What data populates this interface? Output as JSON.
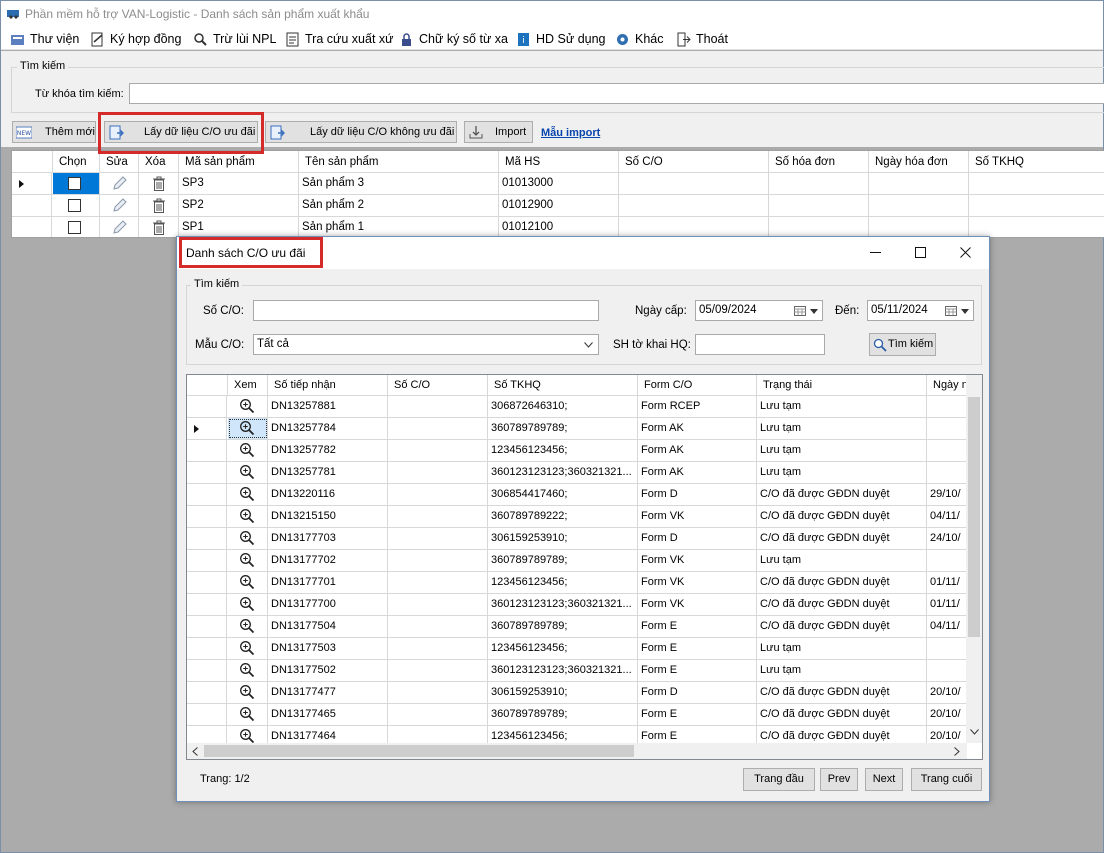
{
  "window": {
    "title": "Phần mềm hỗ trợ VAN-Logistic - Danh sách sản phẩm xuất khẩu"
  },
  "menu": [
    {
      "label": "Thư viện",
      "icon": "library-icon"
    },
    {
      "label": "Ký hợp đồng",
      "icon": "sign-contract-icon"
    },
    {
      "label": "Trừ lùi NPL",
      "icon": "search-deduct-icon"
    },
    {
      "label": "Tra cứu xuất xứ",
      "icon": "lookup-origin-icon"
    },
    {
      "label": "Chữ ký số từ xa",
      "icon": "remote-signature-icon"
    },
    {
      "label": "HD Sử dụng",
      "icon": "help-icon"
    },
    {
      "label": "Khác",
      "icon": "gear-icon"
    },
    {
      "label": "Thoát",
      "icon": "exit-icon"
    }
  ],
  "search": {
    "group_label": "Tìm kiếm",
    "keyword_label": "Từ khóa tìm kiếm:",
    "keyword_value": ""
  },
  "toolbar": {
    "add_new": "Thêm mới",
    "get_preferential": "Lấy dữ liệu C/O ưu đãi",
    "get_non_preferential": "Lấy dữ liệu C/O không ưu đãi",
    "import": "Import",
    "import_template": "Mẫu import"
  },
  "product_grid": {
    "columns": [
      "Chọn",
      "Sửa",
      "Xóa",
      "Mã sản phẩm",
      "Tên sản phẩm",
      "Mã HS",
      "Số C/O",
      "Số hóa đơn",
      "Ngày hóa đơn",
      "Số TKHQ"
    ],
    "rows": [
      {
        "code": "SP3",
        "name": "Sản phẩm 3",
        "hs": "01013000",
        "co": "",
        "invoice": "",
        "invoice_date": "",
        "tkhq": ""
      },
      {
        "code": "SP2",
        "name": "Sản phẩm 2",
        "hs": "01012900",
        "co": "",
        "invoice": "",
        "invoice_date": "",
        "tkhq": ""
      },
      {
        "code": "SP1",
        "name": "Sản phẩm 1",
        "hs": "01012100",
        "co": "",
        "invoice": "",
        "invoice_date": "",
        "tkhq": ""
      }
    ]
  },
  "dialog": {
    "title": "Danh sách C/O ưu đãi",
    "search_group": "Tìm kiếm",
    "co_number_label": "Số C/O:",
    "co_number_value": "",
    "issue_date_label": "Ngày cấp:",
    "date_from": "05/09/2024",
    "to_label": "Đến:",
    "date_to": "05/11/2024",
    "form_label": "Mẫu C/O:",
    "form_value": "Tất cả",
    "declaration_label": "SH tờ khai HQ:",
    "declaration_value": "",
    "search_button": "Tìm kiếm",
    "grid": {
      "columns": [
        "Xem",
        "Số tiếp nhận",
        "Số C/O",
        "Số TKHQ",
        "Form C/O",
        "Trạng thái",
        "Ngày n"
      ],
      "rows": [
        {
          "receipt": "DN13257881",
          "co": "",
          "tkhq": "306872646310;",
          "form": "Form RCEP",
          "status": "Lưu tạm",
          "date": ""
        },
        {
          "receipt": "DN13257784",
          "co": "",
          "tkhq": "360789789789;",
          "form": "Form AK",
          "status": "Lưu tạm",
          "date": ""
        },
        {
          "receipt": "DN13257782",
          "co": "",
          "tkhq": "123456123456;",
          "form": "Form AK",
          "status": "Lưu tạm",
          "date": ""
        },
        {
          "receipt": "DN13257781",
          "co": "",
          "tkhq": "360123123123;360321321...",
          "form": "Form AK",
          "status": "Lưu tạm",
          "date": ""
        },
        {
          "receipt": "DN13220116",
          "co": "",
          "tkhq": "306854417460;",
          "form": "Form D",
          "status": "C/O đã được GĐDN duyệt",
          "date": "29/10/"
        },
        {
          "receipt": "DN13215150",
          "co": "",
          "tkhq": "360789789222;",
          "form": "Form VK",
          "status": "C/O đã được GĐDN duyệt",
          "date": "04/11/"
        },
        {
          "receipt": "DN13177703",
          "co": "",
          "tkhq": "306159253910;",
          "form": "Form D",
          "status": "C/O đã được GĐDN duyệt",
          "date": "24/10/"
        },
        {
          "receipt": "DN13177702",
          "co": "",
          "tkhq": "360789789789;",
          "form": "Form VK",
          "status": "Lưu tạm",
          "date": ""
        },
        {
          "receipt": "DN13177701",
          "co": "",
          "tkhq": "123456123456;",
          "form": "Form VK",
          "status": "C/O đã được GĐDN duyệt",
          "date": "01/11/"
        },
        {
          "receipt": "DN13177700",
          "co": "",
          "tkhq": "360123123123;360321321...",
          "form": "Form VK",
          "status": "C/O đã được GĐDN duyệt",
          "date": "01/11/"
        },
        {
          "receipt": "DN13177504",
          "co": "",
          "tkhq": "360789789789;",
          "form": "Form E",
          "status": "C/O đã được GĐDN duyệt",
          "date": "04/11/"
        },
        {
          "receipt": "DN13177503",
          "co": "",
          "tkhq": "123456123456;",
          "form": "Form E",
          "status": "Lưu tạm",
          "date": ""
        },
        {
          "receipt": "DN13177502",
          "co": "",
          "tkhq": "360123123123;360321321...",
          "form": "Form E",
          "status": "Lưu tạm",
          "date": ""
        },
        {
          "receipt": "DN13177477",
          "co": "",
          "tkhq": "306159253910;",
          "form": "Form D",
          "status": "C/O đã được GĐDN duyệt",
          "date": "20/10/"
        },
        {
          "receipt": "DN13177465",
          "co": "",
          "tkhq": "360789789789;",
          "form": "Form E",
          "status": "C/O đã được GĐDN duyệt",
          "date": "20/10/"
        },
        {
          "receipt": "DN13177464",
          "co": "",
          "tkhq": "123456123456;",
          "form": "Form E",
          "status": "C/O đã được GĐDN duyệt",
          "date": "20/10/"
        }
      ]
    },
    "pager": {
      "page_text": "Trang: 1/2",
      "first": "Trang đầu",
      "prev": "Prev",
      "next": "Next",
      "last": "Trang cuối"
    }
  },
  "colors": {
    "highlight": "#d42a2a",
    "selected_cell": "#0078d7",
    "link": "#0645ad"
  }
}
